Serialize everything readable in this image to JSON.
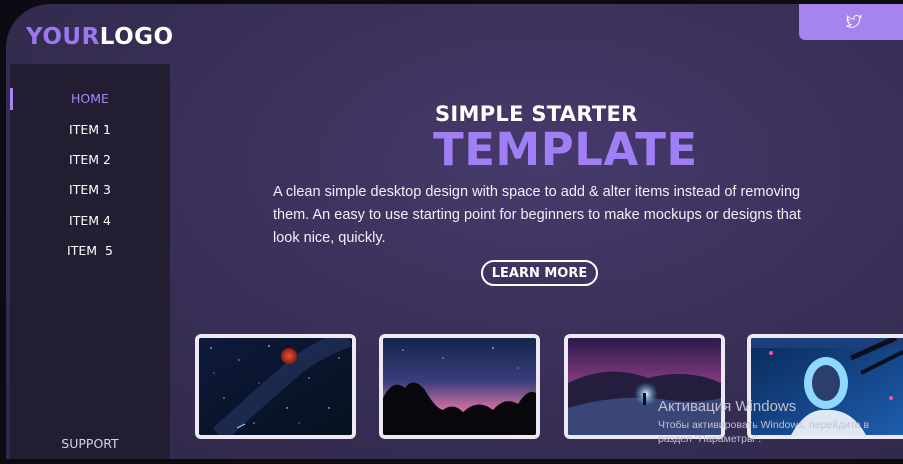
{
  "brand": {
    "logo_part1": "YOUR",
    "logo_part2": "LOGO"
  },
  "social": {
    "icon": "twitter-icon"
  },
  "sidebar": {
    "items": [
      {
        "label": "HOME",
        "active": true
      },
      {
        "label": "ITEM 1"
      },
      {
        "label": "ITEM 2"
      },
      {
        "label": "ITEM 3"
      },
      {
        "label": "ITEM 4"
      },
      {
        "label": "ITEM  5"
      }
    ],
    "support_label": "SUPPORT"
  },
  "hero": {
    "kicker": "SIMPLE STARTER",
    "title": "TEMPLATE",
    "description": "A clean simple desktop design with space to add & alter items instead of removing them. An easy to use starting point for beginners to make mockups or designs that look nice, quickly.",
    "cta_label": "LEARN MORE"
  },
  "gallery": {
    "items": [
      {
        "subject": "starry-sky-red-moon"
      },
      {
        "subject": "rock-silhouette-dusk"
      },
      {
        "subject": "night-snow-figure-orb"
      },
      {
        "subject": "cyberpunk-robot-figure"
      }
    ]
  },
  "os_watermark": {
    "line1": "Активация Windows",
    "line2": "Чтобы активировать Windows, перейдите в",
    "line3": "раздел \"Параметры\"."
  },
  "colors": {
    "accent": "#a07ef3",
    "background": "#3a3059",
    "sidebar": "#221d31",
    "text": "#ffffff"
  }
}
